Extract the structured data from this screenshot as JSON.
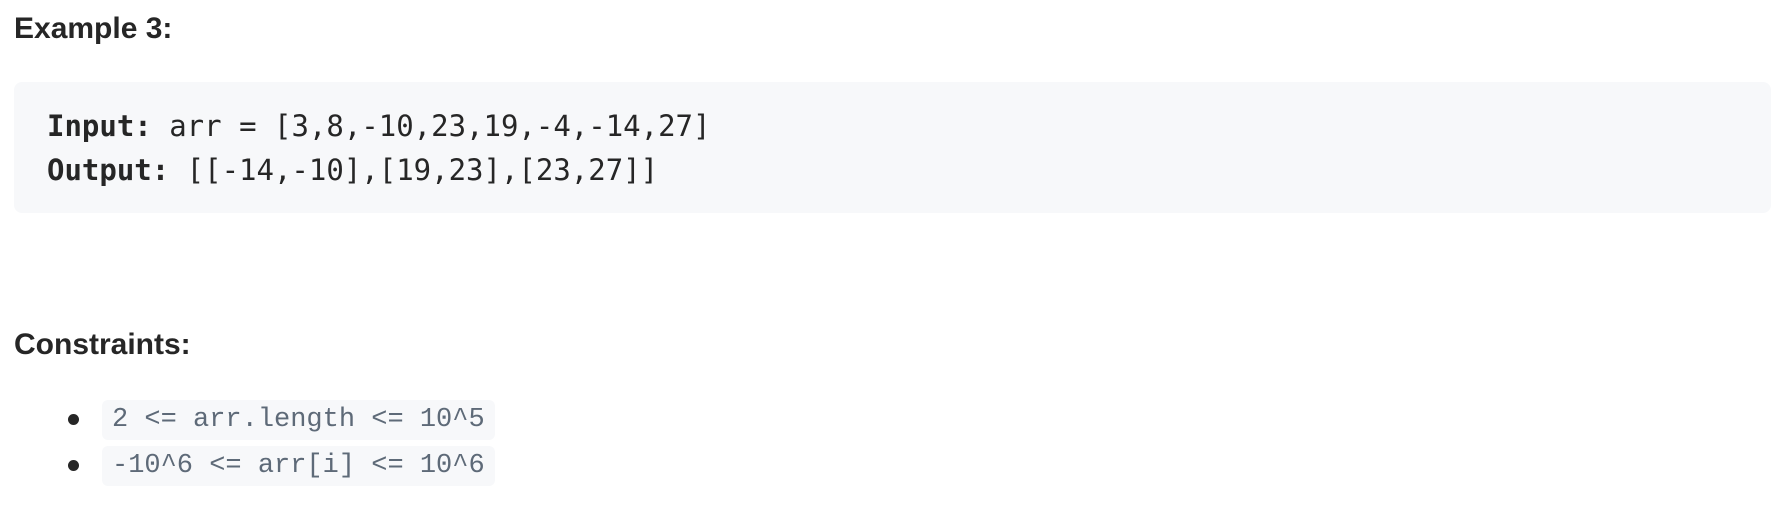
{
  "example": {
    "heading": "Example 3:",
    "input_label": "Input:",
    "input_value": " arr = [3,8,-10,23,19,-4,-14,27]",
    "output_label": "Output:",
    "output_value": " [[-14,-10],[19,23],[23,27]]"
  },
  "constraints": {
    "heading": "Constraints:",
    "items": [
      "2 <= arr.length <= 10^5",
      "-10^6 <= arr[i] <= 10^6"
    ]
  }
}
